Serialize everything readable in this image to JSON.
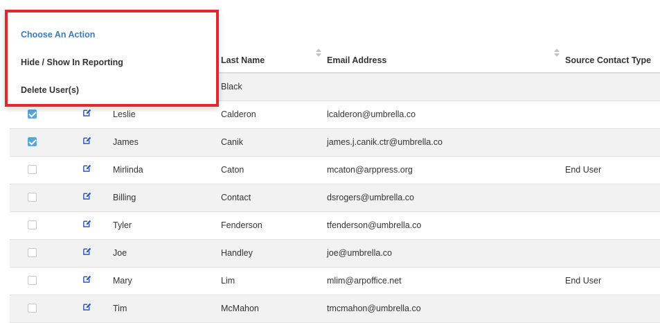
{
  "actions_menu": {
    "title": "Choose An Action",
    "items": [
      "Hide / Show In Reporting",
      "Delete User(s)"
    ],
    "highlight_color": "#e0282e"
  },
  "table": {
    "columns": {
      "last_name": "Last Name",
      "email": "Email Address",
      "source_contact_type": "Source Contact Type"
    },
    "rows": [
      {
        "checked": false,
        "first_name": "",
        "last_name": "Black",
        "email": "",
        "type": ""
      },
      {
        "checked": true,
        "first_name": "Leslie",
        "last_name": "Calderon",
        "email": "lcalderon@umbrella.co",
        "type": ""
      },
      {
        "checked": true,
        "first_name": "James",
        "last_name": "Canik",
        "email": "james.j.canik.ctr@umbrella.co",
        "type": ""
      },
      {
        "checked": false,
        "first_name": "Mirlinda",
        "last_name": "Caton",
        "email": "mcaton@arppress.org",
        "type": "End User"
      },
      {
        "checked": false,
        "first_name": "Billing",
        "last_name": "Contact",
        "email": "dsrogers@umbrella.co",
        "type": ""
      },
      {
        "checked": false,
        "first_name": "Tyler",
        "last_name": "Fenderson",
        "email": "tfenderson@umbrella.co",
        "type": ""
      },
      {
        "checked": false,
        "first_name": "Joe",
        "last_name": "Handley",
        "email": "joe@umbrella.co",
        "type": ""
      },
      {
        "checked": false,
        "first_name": "Mary",
        "last_name": "Lim",
        "email": "mlim@arpoffice.net",
        "type": "End User"
      },
      {
        "checked": false,
        "first_name": "Tim",
        "last_name": "McMahon",
        "email": "tmcmahon@umbrella.co",
        "type": ""
      }
    ]
  },
  "icons": {
    "edit": "edit-icon",
    "sort": "sort-icon",
    "checkbox": "checkbox"
  },
  "colors": {
    "checkbox_checked": "#5aa7d3",
    "edit_icon": "#2f57d6",
    "menu_title": "#3b7bbd",
    "row_stripe": "#f2f2f2"
  }
}
